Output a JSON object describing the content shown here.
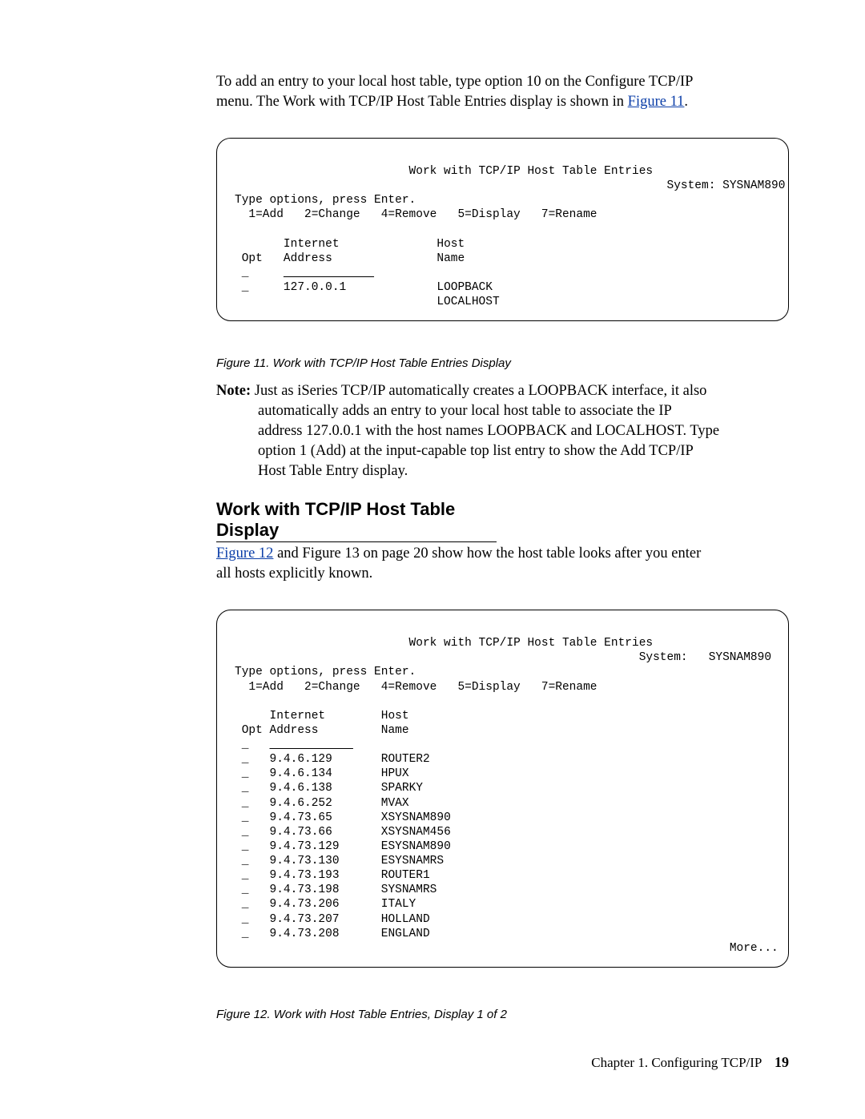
{
  "intro": {
    "l1": "To add an entry to your local host table, type option 10 on the Configure TCP/IP",
    "l2a": "menu. The Work with TCP/IP Host Table Entries display is shown in ",
    "fig11_link": "Figure 11",
    "l2b": "."
  },
  "term1": {
    "title": "Work with TCP/IP Host Table Entries",
    "system_label": "System: SYSNAM890",
    "instr": "Type options, press Enter.",
    "opts": "  1=Add   2=Change   4=Remove   5=Display   7=Rename",
    "col_internet": "Internet",
    "col_host": "Host",
    "col_opt": "Opt",
    "col_address": "Address",
    "col_name": "Name",
    "entry_ip": "127.0.0.1",
    "entry_h1": "LOOPBACK",
    "entry_h2": "LOCALHOST",
    "blank_line": " _     _____________"
  },
  "fig11_caption": "Figure 11. Work with TCP/IP Host Table Entries Display",
  "note": {
    "label": "Note:",
    "l1": " Just as iSeries TCP/IP automatically creates a LOOPBACK interface, it also",
    "l2": "automatically adds an entry to your local host table to associate the IP",
    "l3": "address 127.0.0.1 with the host names LOOPBACK and LOCALHOST. Type",
    "l4": "option 1 (Add) at the input-capable top list entry to show the Add TCP/IP",
    "l5": "Host Table Entry display."
  },
  "heading": "Work with TCP/IP Host Table Display",
  "after": {
    "fig12_link": "Figure 12",
    "rest1": " and Figure 13 on page 20 show how the host table looks after you enter",
    "rest2": "all hosts explicitly known."
  },
  "term2": {
    "title": "Work with TCP/IP Host Table Entries",
    "system_line": "System:   SYSNAM890",
    "instr": "Type options, press Enter.",
    "opts": "  1=Add   2=Change   4=Remove   5=Display   7=Rename",
    "hdr_internet": "Internet",
    "hdr_host": "Host",
    "hdr_opt": "Opt",
    "hdr_address": "Address",
    "hdr_name": "Name",
    "rows": [
      {
        "ip": "9.4.6.129",
        "host": "ROUTER2"
      },
      {
        "ip": "9.4.6.134",
        "host": "HPUX"
      },
      {
        "ip": "9.4.6.138",
        "host": "SPARKY"
      },
      {
        "ip": "9.4.6.252",
        "host": "MVAX"
      },
      {
        "ip": "9.4.73.65",
        "host": "XSYSNAM890"
      },
      {
        "ip": "9.4.73.66",
        "host": "XSYSNAM456"
      },
      {
        "ip": "9.4.73.129",
        "host": "ESYSNAM890"
      },
      {
        "ip": "9.4.73.130",
        "host": "ESYSNAMRS"
      },
      {
        "ip": "9.4.73.193",
        "host": "ROUTER1"
      },
      {
        "ip": "9.4.73.198",
        "host": "SYSNAMRS"
      },
      {
        "ip": "9.4.73.206",
        "host": "ITALY"
      },
      {
        "ip": "9.4.73.207",
        "host": "HOLLAND"
      },
      {
        "ip": "9.4.73.208",
        "host": "ENGLAND"
      }
    ],
    "more": "More..."
  },
  "fig12_caption": "Figure 12. Work with Host Table Entries, Display 1 of 2",
  "footer_chapter": "Chapter 1. Configuring TCP/IP",
  "footer_page": "19"
}
